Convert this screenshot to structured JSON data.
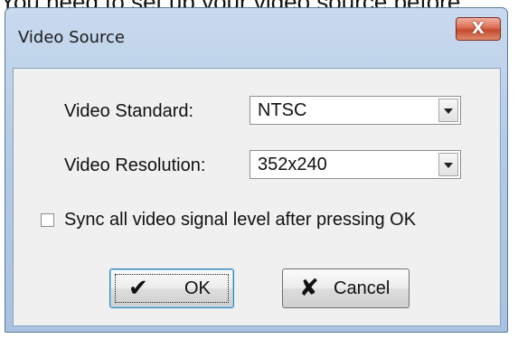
{
  "background_text": "You need to set up your video source before",
  "window": {
    "title": "Video Source",
    "close_symbol": "X"
  },
  "form": {
    "standard_label": "Video Standard:",
    "standard_value": "NTSC",
    "resolution_label": "Video Resolution:",
    "resolution_value": "352x240",
    "sync_label": "Sync all video signal level after pressing OK",
    "sync_checked": false
  },
  "buttons": {
    "ok_icon": "✔",
    "ok_label": "OK",
    "cancel_icon": "✘",
    "cancel_label": "Cancel"
  },
  "icons": {
    "ok": "checkmark-icon",
    "cancel": "x-mark-icon",
    "dropdown": "chevron-down-icon"
  }
}
